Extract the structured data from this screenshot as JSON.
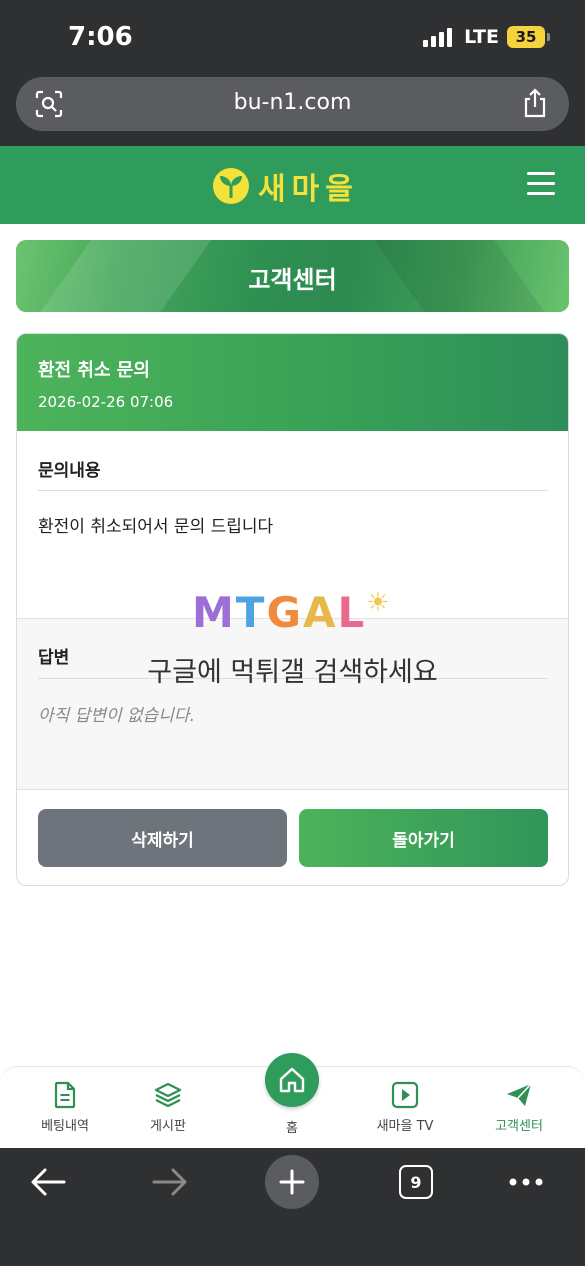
{
  "status": {
    "time": "7:06",
    "network": "LTE",
    "battery": "35"
  },
  "browser": {
    "url": "bu-n1.com",
    "tab_count": "9"
  },
  "header": {
    "logo_text": "새마을"
  },
  "banner": {
    "title": "고객센터"
  },
  "inquiry": {
    "title": "환전 취소 문의",
    "date": "2026-02-26 07:06",
    "content_label": "문의내용",
    "content_text": "환전이 취소되어서 문의 드립니다",
    "answer_label": "답변",
    "answer_text": "아직 답변이 없습니다."
  },
  "buttons": {
    "delete": "삭제하기",
    "back": "돌아가기"
  },
  "watermark": {
    "logo": "MTGAL",
    "text": "구글에 먹튀갤 검색하세요"
  },
  "nav": [
    {
      "label": "베팅내역",
      "icon": "document-icon"
    },
    {
      "label": "게시판",
      "icon": "layers-icon"
    },
    {
      "label": "홈",
      "icon": "home-icon"
    },
    {
      "label": "새마을 TV",
      "icon": "play-icon"
    },
    {
      "label": "고객센터",
      "icon": "send-icon"
    }
  ],
  "colors": {
    "brand_green": "#2f9c5c",
    "logo_yellow": "#f4e23b",
    "delete_gray": "#6d747b"
  }
}
